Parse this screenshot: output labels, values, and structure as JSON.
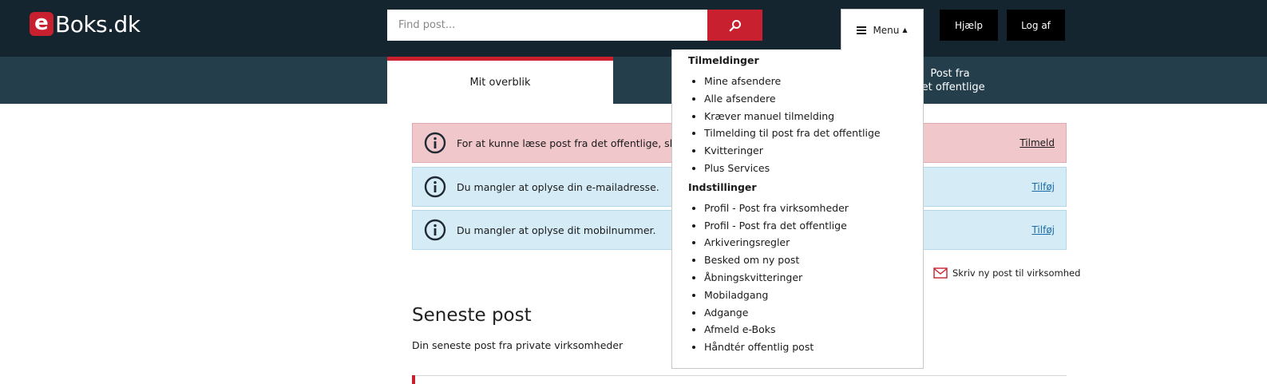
{
  "logo": {
    "e": "e",
    "rest": "Boks.dk"
  },
  "search": {
    "placeholder": "Find post..."
  },
  "header": {
    "menu_label": "Menu",
    "help_label": "Hjælp",
    "logout_label": "Log af"
  },
  "nav": {
    "tab_overview": "Mit overblik",
    "tab_public": "Post fra\ndet offentlige"
  },
  "notices": [
    {
      "text": "For at kunne læse post fra det offentlige, skal du",
      "link": "Tilmeld"
    },
    {
      "text": "Du mangler at oplyse din e-mailadresse.",
      "link": "Tilføj"
    },
    {
      "text": "Du mangler at oplyse dit mobilnummer.",
      "link": "Tilføj"
    }
  ],
  "compose_label": "Skriv ny post til virksomhed",
  "latest": {
    "title": "Seneste post",
    "subtitle": "Din seneste post fra private virksomheder"
  },
  "menu": {
    "sections": [
      {
        "heading": "Tilmeldinger",
        "items": [
          "Mine afsendere",
          "Alle afsendere",
          "Kræver manuel tilmelding",
          "Tilmelding til post fra det offentlige",
          "Kvitteringer",
          "Plus Services"
        ]
      },
      {
        "heading": "Indstillinger",
        "items": [
          "Profil - Post fra virksomheder",
          "Profil - Post fra det offentlige",
          "Arkiveringsregler",
          "Besked om ny post",
          "Åbningskvitteringer",
          "Mobiladgang",
          "Adgange",
          "Afmeld e-Boks",
          "Håndtér offentlig post"
        ]
      }
    ]
  },
  "colors": {
    "brand_red": "#c8202f",
    "header_dark": "#152530",
    "nav_bar": "#243e4c",
    "notice_red": "#f0c7cb",
    "notice_blue": "#d5ecf6"
  }
}
